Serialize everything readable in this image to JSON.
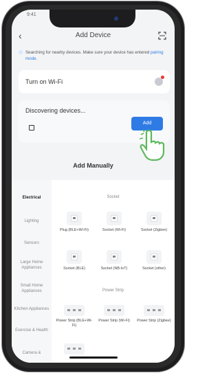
{
  "status": {
    "left": "9:41",
    "right": ""
  },
  "header": {
    "title": "Add Device",
    "back_icon": "chevron-left-icon",
    "scan_icon": "scan-icon"
  },
  "search_note": {
    "text": "Searching for nearby devices. Make sure your device has entered",
    "link": "pairing mode",
    "suffix": "."
  },
  "wifi_card": {
    "label": "Turn on Wi-Fi",
    "icon": "wifi-toggle-icon"
  },
  "discover_card": {
    "label": "Discovering devices...",
    "button_label": "Add"
  },
  "add_manually": {
    "title": "Add Manually"
  },
  "categories": [
    {
      "label": "Electrical",
      "active": true
    },
    {
      "label": "Lighting",
      "active": false
    },
    {
      "label": "Sensors",
      "active": false
    },
    {
      "label": "Large Home Appliances",
      "active": false
    },
    {
      "label": "Small Home Appliances",
      "active": false
    },
    {
      "label": "Kitchen Appliances",
      "active": false
    },
    {
      "label": "Exercise & Health",
      "active": false
    },
    {
      "label": "Camera &",
      "active": false
    }
  ],
  "groups": {
    "socket": "Socket",
    "power_strip": "Power Strip"
  },
  "devices": {
    "plug_ble_wifi": "Plug (BLE+Wi-Fi)",
    "socket_wifi": "Socket (Wi-Fi)",
    "socket_zigbee": "Socket (Zigbee)",
    "socket_ble": "Socket (BLE)",
    "socket_nbiot": "Socket (NB-IoT)",
    "socket_other": "Socket (other)",
    "strip_ble_wifi": "Power Strip (BLE+Wi-Fi)",
    "strip_wifi": "Power Strip (Wi-Fi)",
    "strip_zigbee": "Power Strip (Zigbee)"
  },
  "colors": {
    "accent": "#2f7be6",
    "badge": "#e53935",
    "hand": "#5cb85c"
  }
}
